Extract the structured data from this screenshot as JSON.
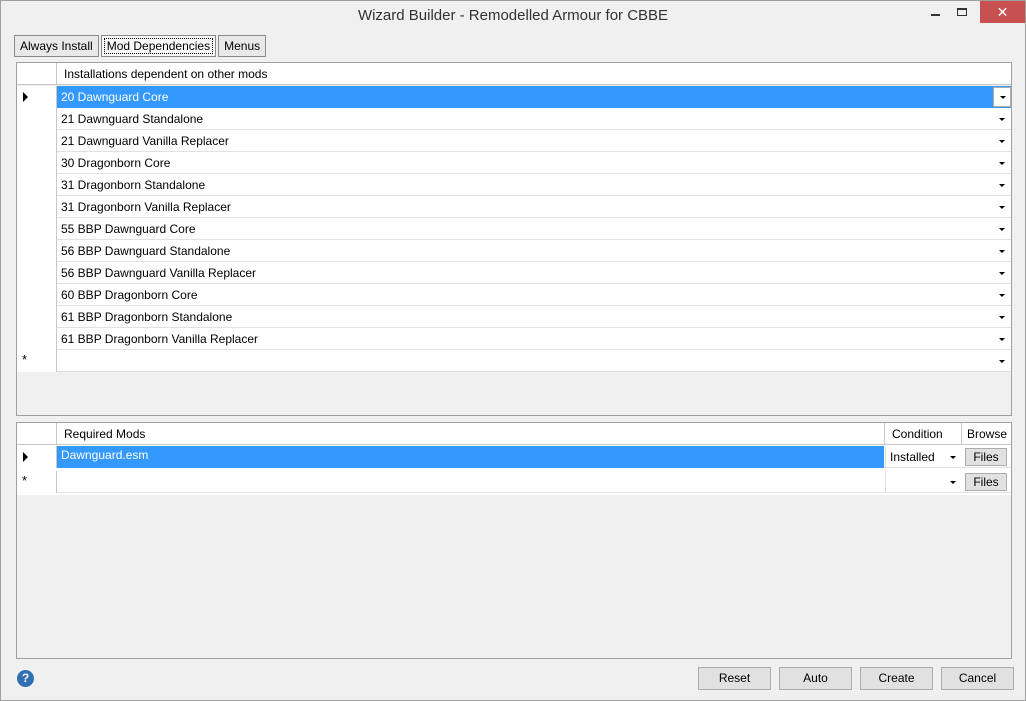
{
  "window": {
    "title": "Wizard Builder - Remodelled Armour for CBBE",
    "close_glyph": "✕"
  },
  "tabs": [
    {
      "label": "Always Install"
    },
    {
      "label": "Mod Dependencies"
    },
    {
      "label": "Menus"
    }
  ],
  "installations_grid": {
    "header": "Installations dependent on other mods",
    "rows": [
      "20 Dawnguard Core",
      "21 Dawnguard Standalone",
      "21 Dawnguard Vanilla Replacer",
      "30 Dragonborn Core",
      "31 Dragonborn Standalone",
      "31 Dragonborn Vanilla Replacer",
      "55 BBP Dawnguard Core",
      "56 BBP Dawnguard Standalone",
      "56 BBP Dawnguard Vanilla Replacer",
      "60 BBP Dragonborn Core",
      "61 BBP Dragonborn Standalone",
      "61 BBP Dragonborn Vanilla Replacer"
    ],
    "new_row_marker": "*"
  },
  "required_mods_grid": {
    "headers": {
      "mod": "Required Mods",
      "condition": "Condition",
      "browse": "Browse"
    },
    "rows": [
      {
        "mod": "Dawnguard.esm",
        "condition": "Installed",
        "browse": "Files"
      }
    ],
    "new_row": {
      "browse": "Files"
    },
    "new_row_marker": "*"
  },
  "footer": {
    "help": "?",
    "reset": "Reset",
    "auto": "Auto",
    "create": "Create",
    "cancel": "Cancel"
  },
  "colors": {
    "selection": "#3399ff",
    "close_button": "#c75050"
  }
}
